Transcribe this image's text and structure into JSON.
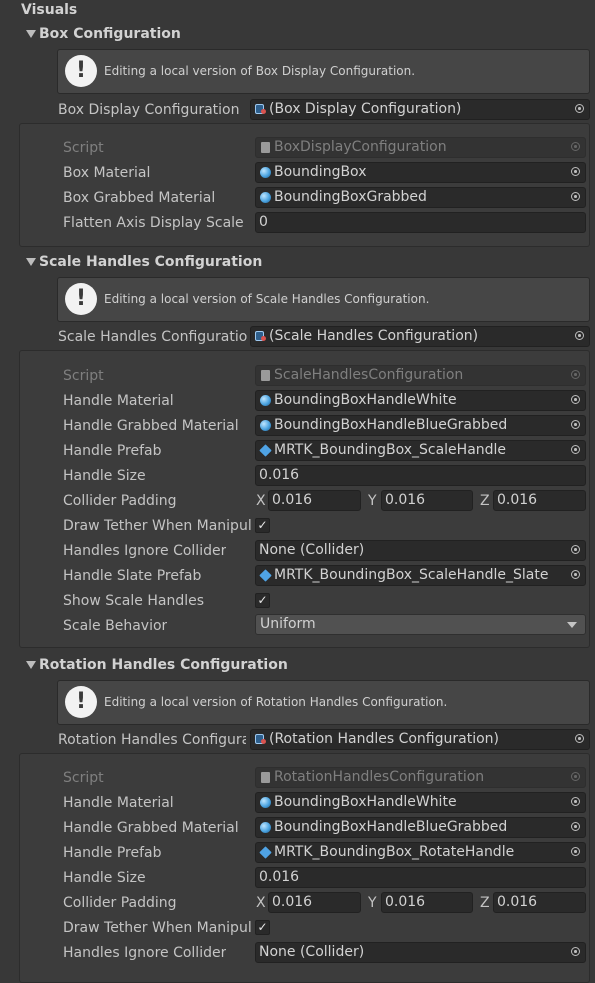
{
  "title": "Visuals",
  "box": {
    "header": "Box Configuration",
    "help": "Editing a local version of Box Display Configuration.",
    "ref_label": "Box Display Configuration",
    "ref_value": "(Box Display Configuration)",
    "script_label": "Script",
    "script_value": "BoxDisplayConfiguration",
    "box_material_label": "Box Material",
    "box_material_value": "BoundingBox",
    "grabbed_material_label": "Box Grabbed Material",
    "grabbed_material_value": "BoundingBoxGrabbed",
    "flatten_label": "Flatten Axis Display Scale",
    "flatten_value": "0"
  },
  "scale": {
    "header": "Scale Handles Configuration",
    "help": "Editing a local version of Scale Handles Configuration.",
    "ref_label": "Scale Handles Configuration",
    "ref_value": "(Scale Handles Configuration)",
    "script_label": "Script",
    "script_value": "ScaleHandlesConfiguration",
    "handle_material_label": "Handle Material",
    "handle_material_value": "BoundingBoxHandleWhite",
    "handle_grabbed_label": "Handle Grabbed Material",
    "handle_grabbed_value": "BoundingBoxHandleBlueGrabbed",
    "handle_prefab_label": "Handle Prefab",
    "handle_prefab_value": "MRTK_BoundingBox_ScaleHandle",
    "handle_size_label": "Handle Size",
    "handle_size_value": "0.016",
    "collider_padding_label": "Collider Padding",
    "padding_x_label": "X",
    "padding_x": "0.016",
    "padding_y_label": "Y",
    "padding_y": "0.016",
    "padding_z_label": "Z",
    "padding_z": "0.016",
    "draw_tether_label": "Draw Tether When Manipulating",
    "draw_tether_checked": true,
    "ignore_collider_label": "Handles Ignore Collider",
    "ignore_collider_value": "None (Collider)",
    "slate_prefab_label": "Handle Slate Prefab",
    "slate_prefab_value": "MRTK_BoundingBox_ScaleHandle_Slate",
    "show_handles_label": "Show Scale Handles",
    "show_handles_checked": true,
    "behavior_label": "Scale Behavior",
    "behavior_value": "Uniform"
  },
  "rotation": {
    "header": "Rotation Handles Configuration",
    "help": "Editing a local version of Rotation Handles Configuration.",
    "ref_label": "Rotation Handles Configuration",
    "ref_value": "(Rotation Handles Configuration)",
    "script_label": "Script",
    "script_value": "RotationHandlesConfiguration",
    "handle_material_label": "Handle Material",
    "handle_material_value": "BoundingBoxHandleWhite",
    "handle_grabbed_label": "Handle Grabbed Material",
    "handle_grabbed_value": "BoundingBoxHandleBlueGrabbed",
    "handle_prefab_label": "Handle Prefab",
    "handle_prefab_value": "MRTK_BoundingBox_RotateHandle",
    "handle_size_label": "Handle Size",
    "handle_size_value": "0.016",
    "collider_padding_label": "Collider Padding",
    "padding_x_label": "X",
    "padding_x": "0.016",
    "padding_y_label": "Y",
    "padding_y": "0.016",
    "padding_z_label": "Z",
    "padding_z": "0.016",
    "draw_tether_label": "Draw Tether When Manipulating",
    "draw_tether_checked": true,
    "ignore_collider_label": "Handles Ignore Collider",
    "ignore_collider_value": "None (Collider)"
  },
  "icons": {
    "warning": "!",
    "check": "✓"
  }
}
